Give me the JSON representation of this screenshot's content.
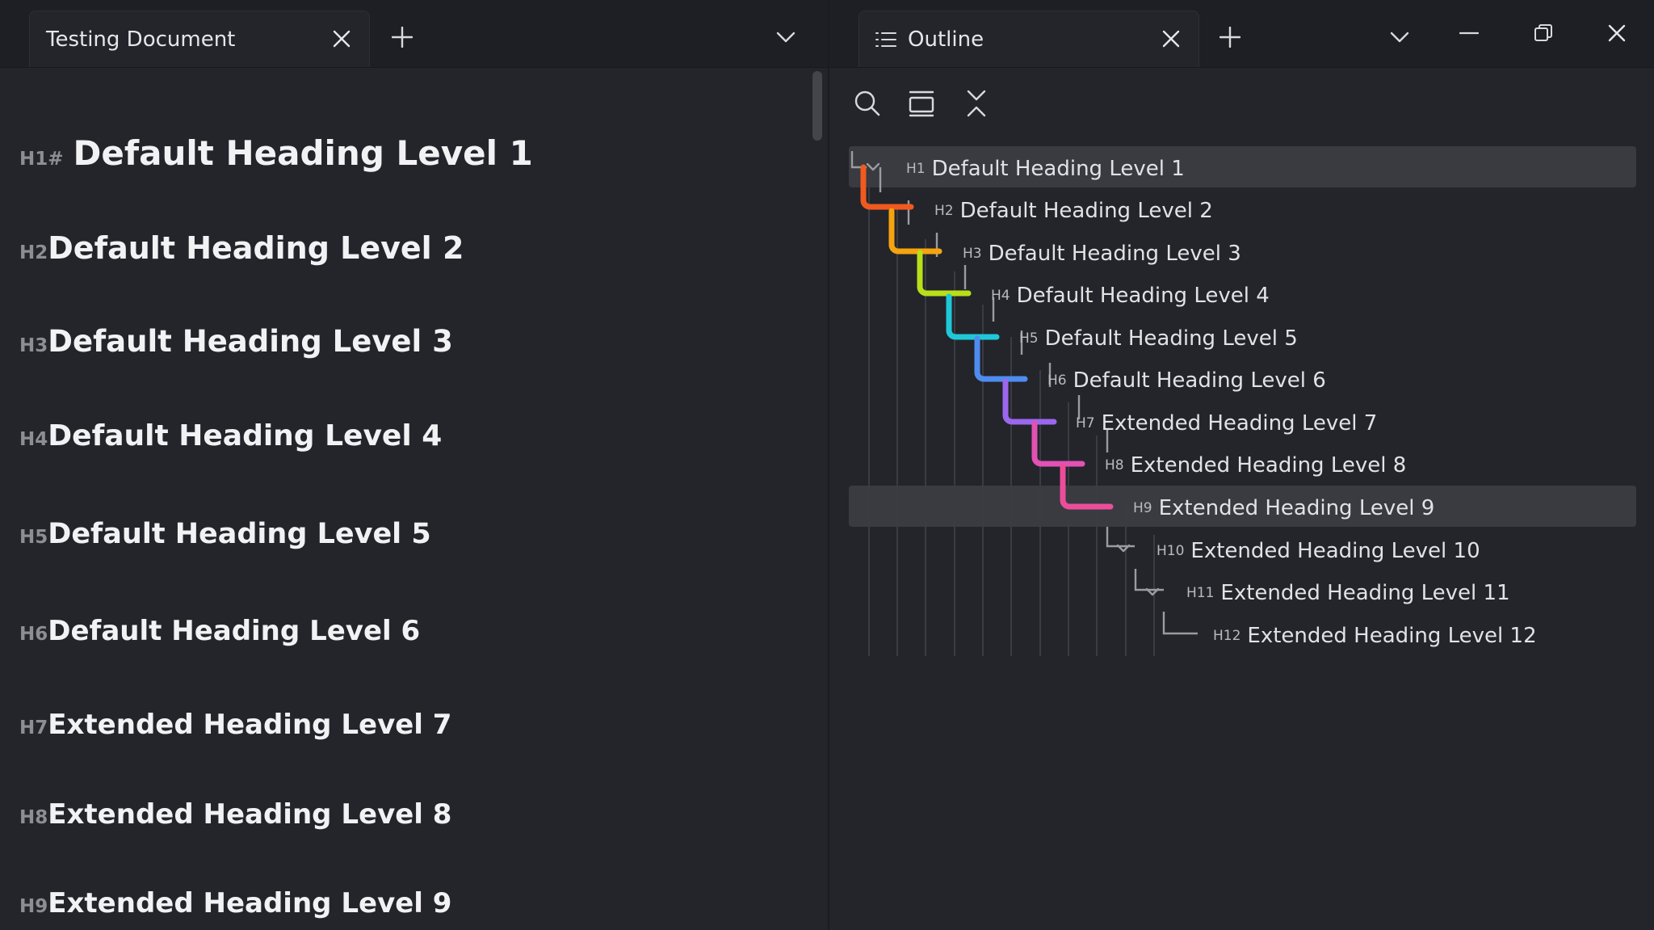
{
  "left_tab": {
    "title": "Testing Document"
  },
  "right_tab": {
    "title": "Outline"
  },
  "colors": {
    "accent": "#2f7fe0",
    "background": "#23252b",
    "tabbar": "#1e1f24",
    "highlight": "#393b41",
    "rainbow": [
      "#f05a1e",
      "#f5a30f",
      "#b9df19",
      "#1fc8d8",
      "#4f8cf0",
      "#9b67ee",
      "#e251b4",
      "#ec4d9a"
    ]
  },
  "icons": {
    "tab_close": "close-icon",
    "new_tab": "plus-icon",
    "tab_menu": "chevron-down-icon",
    "outline_tab": "list-icon",
    "search": "search-icon",
    "view_mode": "panel-icon",
    "collapse": "collapse-icon",
    "minimize": "minimize-icon",
    "restore": "restore-icon",
    "close_window": "close-icon"
  },
  "document": {
    "headings": [
      {
        "marker": "H1#",
        "text": "Default Heading Level 1"
      },
      {
        "marker": "H2",
        "text": "Default Heading Level 2"
      },
      {
        "marker": "H3",
        "text": "Default Heading Level 3"
      },
      {
        "marker": "H4",
        "text": "Default Heading Level 4"
      },
      {
        "marker": "H5",
        "text": "Default Heading Level 5"
      },
      {
        "marker": "H6",
        "text": "Default Heading Level 6"
      },
      {
        "marker": "H7",
        "text": "Extended Heading Level 7"
      },
      {
        "marker": "H8",
        "text": "Extended Heading Level 8"
      },
      {
        "marker": "H9",
        "text": "Extended Heading Level 9"
      }
    ]
  },
  "outline": {
    "items": [
      {
        "tag": "H1",
        "label": "Default Heading Level 1"
      },
      {
        "tag": "H2",
        "label": "Default Heading Level 2"
      },
      {
        "tag": "H3",
        "label": "Default Heading Level 3"
      },
      {
        "tag": "H4",
        "label": "Default Heading Level 4"
      },
      {
        "tag": "H5",
        "label": "Default Heading Level 5"
      },
      {
        "tag": "H6",
        "label": "Default Heading Level 6"
      },
      {
        "tag": "H7",
        "label": "Extended Heading Level 7"
      },
      {
        "tag": "H8",
        "label": "Extended Heading Level 8"
      },
      {
        "tag": "H9",
        "label": "Extended Heading Level 9"
      },
      {
        "tag": "H10",
        "label": "Extended Heading Level 10"
      },
      {
        "tag": "H11",
        "label": "Extended Heading Level 11"
      },
      {
        "tag": "H12",
        "label": "Extended Heading Level 12"
      }
    ]
  }
}
